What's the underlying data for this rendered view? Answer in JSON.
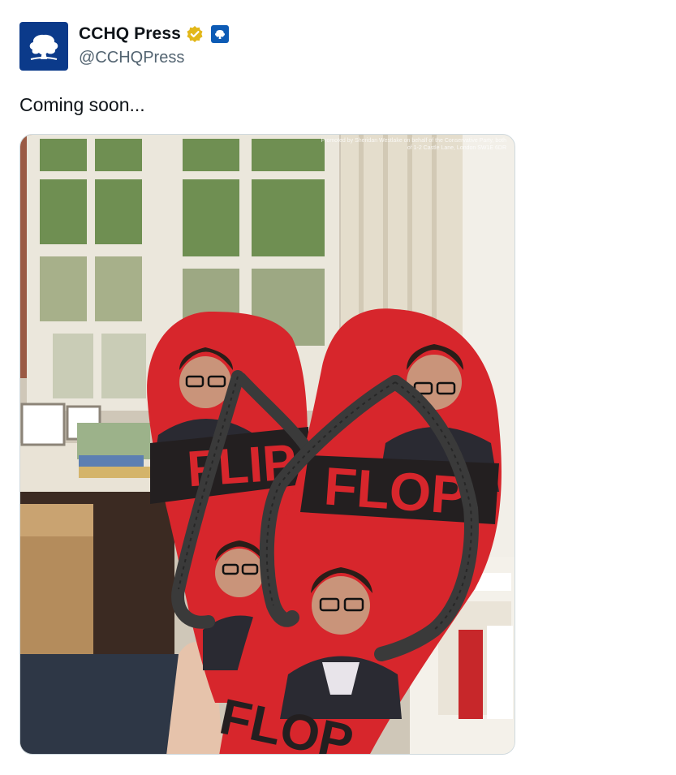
{
  "account": {
    "display_name": "CCHQ Press",
    "handle": "@CCHQPress",
    "verified_badge": "gold-verified-badge",
    "affiliation_badge": "affiliate-badge",
    "brand_color": "#0b3a8a"
  },
  "tweet": {
    "text": "Coming soon...",
    "image": {
      "promoted_by": "Promoted by Sheridan Westlake on behalf of the Conservative Party, both of 1-2 Castle Lane, London SW1E 6DR",
      "left_sandal_text": "FLIP",
      "right_sandal_text": "FLOP",
      "bottom_sandal_text": "FLOP",
      "sandal_color": "#d7262c"
    }
  }
}
